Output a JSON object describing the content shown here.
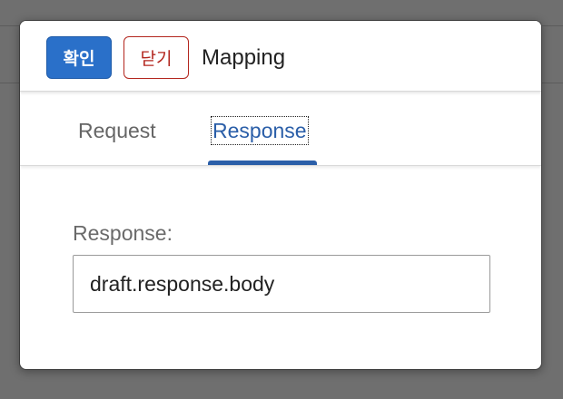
{
  "dialog": {
    "confirm_label": "확인",
    "close_label": "닫기",
    "title": "Mapping"
  },
  "tabs": [
    {
      "label": "Request",
      "selected": false
    },
    {
      "label": "Response",
      "selected": true
    }
  ],
  "response_field": {
    "label": "Response:",
    "value": "draft.response.body"
  },
  "colors": {
    "accent": "#2a70c9",
    "tab_active": "#2a5ea8",
    "close_red": "#b3261e"
  }
}
